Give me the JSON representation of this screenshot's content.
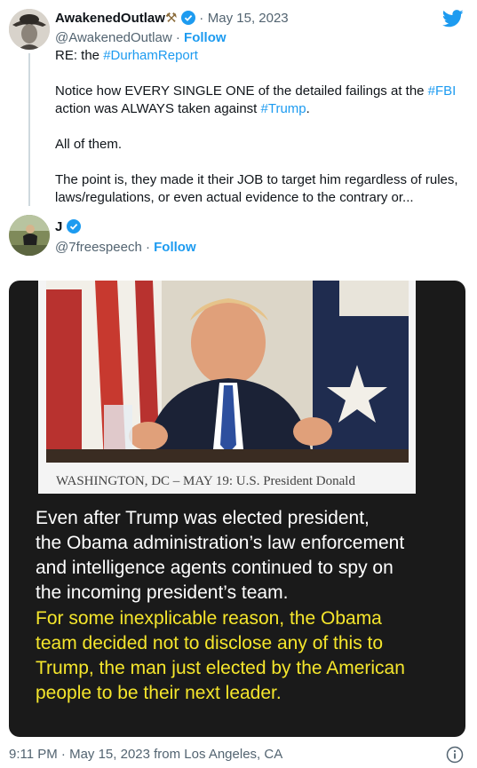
{
  "quoted_tweet": {
    "display_name": "AwakenedOutlaw",
    "name_emoji": "⚒",
    "date": "May 15, 2023",
    "handle": "@AwakenedOutlaw",
    "follow_label": "Follow",
    "re_prefix": "RE: the ",
    "re_hashtag": "#DurhamReport",
    "p2_a": "Notice how EVERY SINGLE ONE of the detailed failings at the ",
    "p2_tag1": "#FBI",
    "p2_b": "action was ALWAYS taken against ",
    "p2_tag2": "#Trump",
    "p2_c": ".",
    "p3": "All of them.",
    "p4_line1": "The point is, they made it their JOB to target him regardless of rules,",
    "p4_line2": "laws/regulations, or even actual evidence to the contrary or..."
  },
  "reply_tweet": {
    "display_name": "J",
    "handle": "@7freespeech",
    "follow_label": "Follow",
    "media": {
      "photo_caption": "WASHINGTON, DC – MAY 19: U.S. President Donald",
      "text_white": [
        "Even after Trump was elected president,",
        "the Obama administration’s law enforcement",
        "and intelligence agents continued to spy on",
        "the incoming president’s team."
      ],
      "text_yellow": [
        "For some inexplicable reason, the Obama",
        "team decided not to disclose any of this to",
        "Trump, the man just elected by the American",
        "people to be their next leader."
      ]
    },
    "timestamp": "9:11 PM · May 15, 2023 from Los Angeles, CA"
  },
  "colors": {
    "link": "#1d9bf0",
    "caption_yellow": "#f5e62c",
    "verified": "#1d9bf0"
  },
  "icons": [
    "twitter-bird-icon",
    "verified-badge-icon",
    "info-icon"
  ]
}
